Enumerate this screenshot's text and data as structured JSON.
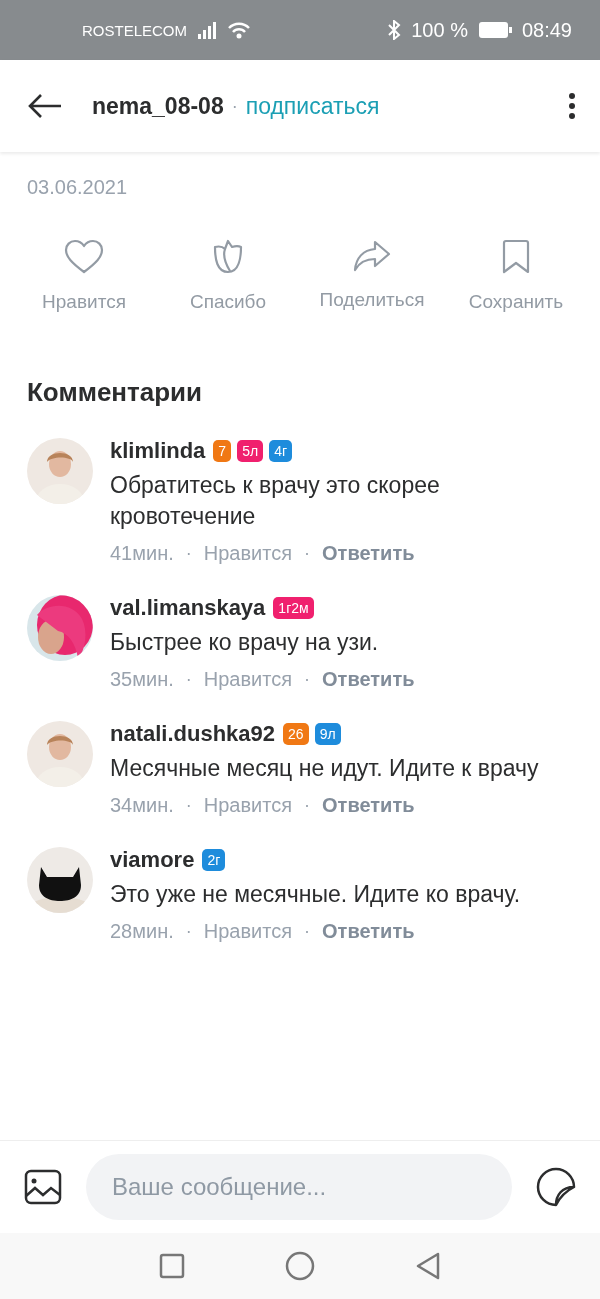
{
  "status_bar": {
    "carrier": "ROSTELECOM",
    "battery": "100 %",
    "time": "08:49"
  },
  "header": {
    "username": "nema_08-08",
    "separator": "·",
    "follow": "подписаться"
  },
  "post": {
    "date": "03.06.2021",
    "actions": [
      {
        "kind": "like",
        "label": "Нравится"
      },
      {
        "kind": "thanks",
        "label": "Спасибо"
      },
      {
        "kind": "share",
        "label": "Поделиться"
      },
      {
        "kind": "save",
        "label": "Сохранить"
      }
    ]
  },
  "comments_title": "Комментарии",
  "comments": [
    {
      "user": "klimlinda",
      "badges": [
        {
          "text": "7",
          "color": "#f07814"
        },
        {
          "text": "5л",
          "color": "#f0206e"
        },
        {
          "text": "4г",
          "color": "#1e8cdc"
        }
      ],
      "text": "Обратитесь к врачу это скорее кровотечение",
      "time": "41мин.",
      "separator": "·",
      "like": "Нравится",
      "reply": "Ответить"
    },
    {
      "user": "val.limanskaya",
      "badges": [
        {
          "text": "1г2м",
          "color": "#f0206e"
        }
      ],
      "text": "Быстрее ко врачу на узи.",
      "time": "35мин.",
      "separator": "·",
      "like": "Нравится",
      "reply": "Ответить"
    },
    {
      "user": "natali.dushka92",
      "badges": [
        {
          "text": "26",
          "color": "#f07814"
        },
        {
          "text": "9л",
          "color": "#1e8cdc"
        }
      ],
      "text": "Месячные месяц не идут. Идите к врачу",
      "time": "34мин.",
      "separator": "·",
      "like": "Нравится",
      "reply": "Ответить"
    },
    {
      "user": "viamore",
      "badges": [
        {
          "text": "2г",
          "color": "#1e8cdc"
        }
      ],
      "text": "Это уже не месячные. Идите ко врачу.",
      "time": "28мин.",
      "separator": "·",
      "like": "Нравится",
      "reply": "Ответить"
    }
  ],
  "composer": {
    "placeholder": "Ваше сообщение..."
  }
}
